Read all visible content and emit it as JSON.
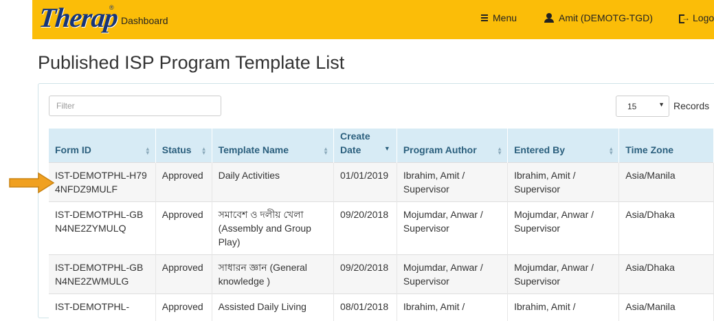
{
  "header": {
    "logo_text": "Therap",
    "logo_mark": "®",
    "dashboard_label": "Dashboard",
    "menu_label": "Menu",
    "user_label": "Amit (DEMOTG-TGD)",
    "logout_label": "Logout"
  },
  "page": {
    "title": "Published ISP Program Template List"
  },
  "controls": {
    "filter_placeholder": "Filter",
    "records_value": "15",
    "records_label": "Records"
  },
  "table": {
    "columns": [
      "Form ID",
      "Status",
      "Template Name",
      "Create Date",
      "Program Author",
      "Entered By",
      "Time Zone"
    ],
    "rows": [
      [
        "IST-DEMOTPHL-H794NFDZ9MULF",
        "Approved",
        "Daily Activities",
        "01/01/2019",
        "Ibrahim, Amit / Supervisor",
        "Ibrahim, Amit / Supervisor",
        "Asia/Manila"
      ],
      [
        "IST-DEMOTPHL-GBN4NE2ZYMULQ",
        "Approved",
        "সমাবেশ ও দলীয় খেলা (Assembly and Group Play)",
        "09/20/2018",
        "Mojumdar, Anwar / Supervisor",
        "Mojumdar, Anwar / Supervisor",
        "Asia/Dhaka"
      ],
      [
        "IST-DEMOTPHL-GBN4NE2ZWMULG",
        "Approved",
        "সাধারন জ্ঞান (General knowledge )",
        "09/20/2018",
        "Mojumdar, Anwar / Supervisor",
        "Mojumdar, Anwar / Supervisor",
        "Asia/Dhaka"
      ],
      [
        "IST-DEMOTPHL-",
        "Approved",
        "Assisted Daily Living",
        "08/01/2018",
        "Ibrahim, Amit /",
        "Ibrahim, Amit /",
        "Asia/Manila"
      ]
    ]
  },
  "colors": {
    "header_bg": "#fbbd08",
    "table_header_bg": "#d7ebf5",
    "arrow_marker": "#f0a020"
  }
}
